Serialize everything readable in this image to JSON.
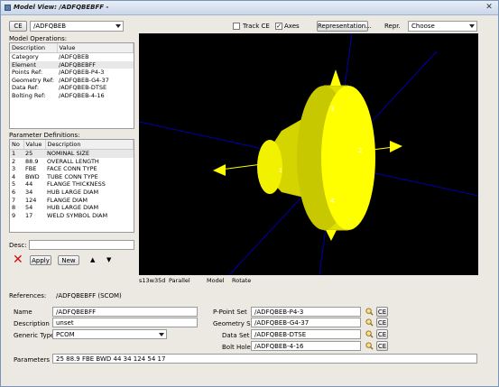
{
  "window": {
    "title": "Model View: /ADFQBEBFF -",
    "close_glyph": "✕"
  },
  "toolbar": {
    "ce_label": "CE",
    "element_value": "/ADFQBEB",
    "track_ce_label": "Track CE",
    "track_ce_checked": false,
    "axes_label": "Axes",
    "axes_checked": true,
    "axes_glyph": "✓",
    "representation_label": "Representation...",
    "repr_label": "Repr.",
    "repr_value": "Choose"
  },
  "model_operations": {
    "heading": "Model Operations:",
    "columns": [
      "Description",
      "Value"
    ],
    "rows": [
      {
        "description": "Category",
        "value": "/ADFQBEB"
      },
      {
        "description": "Element",
        "value": "/ADFQBEBFF"
      },
      {
        "description": "Points Ref:",
        "value": "/ADFQBEB-P4-3"
      },
      {
        "description": "Geometry Ref:",
        "value": "/ADFQBEB-G4-37"
      },
      {
        "description": "Data Ref:",
        "value": "/ADFQBEB-DTSE"
      },
      {
        "description": "Bolting Ref:",
        "value": "/ADFQBEB-4-16"
      }
    ]
  },
  "parameter_definitions": {
    "heading": "Parameter Definitions:",
    "columns": [
      "No",
      "Value",
      "Description"
    ],
    "rows": [
      {
        "no": "1",
        "value": "25",
        "description": "NOMINAL SIZE"
      },
      {
        "no": "2",
        "value": "88.9",
        "description": "OVERALL LENGTH"
      },
      {
        "no": "3",
        "value": "FBE",
        "description": "FACE CONN TYPE"
      },
      {
        "no": "4",
        "value": "BWD",
        "description": "TUBE CONN TYPE"
      },
      {
        "no": "5",
        "value": "44",
        "description": "FLANGE THICKNESS"
      },
      {
        "no": "6",
        "value": "34",
        "description": "HUB LARGE DIAM"
      },
      {
        "no": "7",
        "value": "124",
        "description": "FLANGE DIAM"
      },
      {
        "no": "8",
        "value": "54",
        "description": "HUB LARGE DIAM"
      },
      {
        "no": "9",
        "value": "17",
        "description": "WELD SYMBOL DIAM"
      }
    ]
  },
  "desc": {
    "label": "Desc:",
    "value": ""
  },
  "actions": {
    "delete_glyph": "✕",
    "apply_label": "Apply",
    "new_label": "New",
    "up_glyph": "▲",
    "down_glyph": "▼"
  },
  "viewport": {
    "labels": [
      "1",
      "2",
      "3",
      "4"
    ],
    "status": {
      "view": "s13w35d",
      "projection": "Parallel",
      "mode": "Model",
      "action": "Rotate"
    },
    "colors": {
      "background": "#000000",
      "model": "#ffff00",
      "axis": "#0000aa"
    }
  },
  "form": {
    "references_label": "References:",
    "references_value": "/ADFQBEBFF (SCOM)",
    "name_label": "Name",
    "name_value": "/ADFQBEBFF",
    "description_label": "Description",
    "description_value": "unset",
    "generic_type_label": "Generic Type",
    "generic_type_value": "PCOM",
    "ppoint_label": "P-Point Set",
    "ppoint_value": "/ADFQBEB-P4-3",
    "geometry_label": "Geometry Set",
    "geometry_value": "/ADFQBEB-G4-37",
    "dataset_label": "Data Set",
    "dataset_value": "/ADFQBEB-DTSE",
    "bolt_label": "Bolt Holes",
    "bolt_value": "/ADFQBEB-4-16",
    "ce_label": "CE",
    "parameters_label": "Parameters",
    "parameters_value": "25 88.9 FBE BWD 44 34 124 54 17"
  }
}
